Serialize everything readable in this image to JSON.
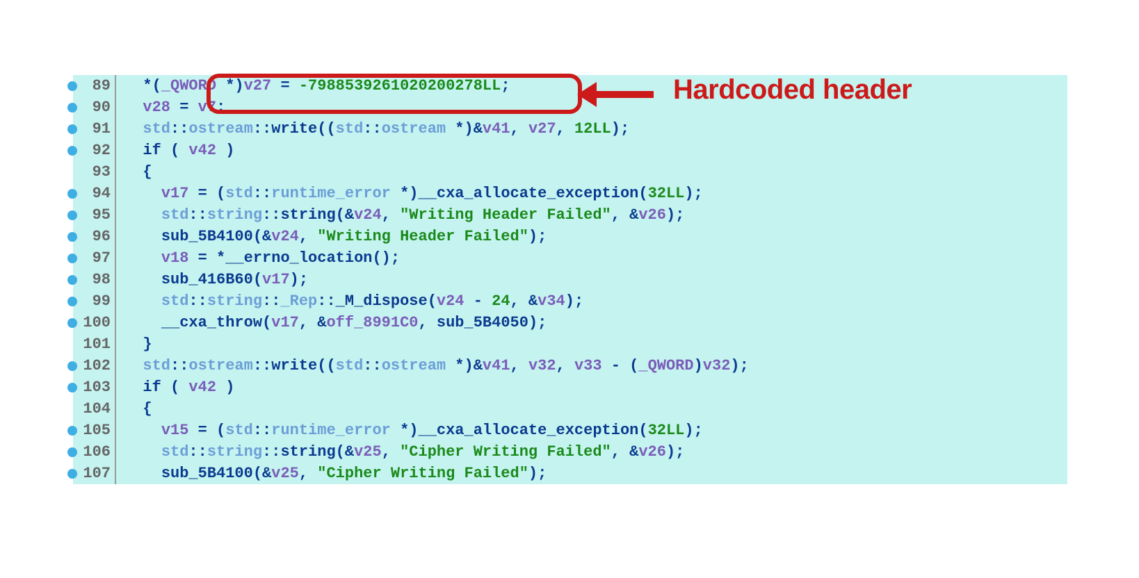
{
  "annotation": {
    "label": "Hardcoded header"
  },
  "lines": [
    {
      "n": "89",
      "bullet": true,
      "tokens": [
        {
          "cls": "tk-punct",
          "t": "  *("
        },
        {
          "cls": "tk-var",
          "t": "_QWORD"
        },
        {
          "cls": "tk-punct",
          "t": " *)"
        },
        {
          "cls": "tk-var",
          "t": "v27"
        },
        {
          "cls": "tk-punct",
          "t": " = "
        },
        {
          "cls": "tk-num",
          "t": "-7988539261020200278LL"
        },
        {
          "cls": "tk-punct",
          "t": ";"
        }
      ]
    },
    {
      "n": "90",
      "bullet": true,
      "tokens": [
        {
          "cls": "tk-punct",
          "t": "  "
        },
        {
          "cls": "tk-var",
          "t": "v28"
        },
        {
          "cls": "tk-punct",
          "t": " = "
        },
        {
          "cls": "tk-var",
          "t": "v7"
        },
        {
          "cls": "tk-punct",
          "t": ";"
        }
      ]
    },
    {
      "n": "91",
      "bullet": true,
      "tokens": [
        {
          "cls": "tk-punct",
          "t": "  "
        },
        {
          "cls": "tk-ns",
          "t": "std"
        },
        {
          "cls": "tk-nsop",
          "t": "::"
        },
        {
          "cls": "tk-ns",
          "t": "ostream"
        },
        {
          "cls": "tk-nsop",
          "t": "::"
        },
        {
          "cls": "tk-fn",
          "t": "write"
        },
        {
          "cls": "tk-punct",
          "t": "(("
        },
        {
          "cls": "tk-ns",
          "t": "std"
        },
        {
          "cls": "tk-nsop",
          "t": "::"
        },
        {
          "cls": "tk-ns",
          "t": "ostream"
        },
        {
          "cls": "tk-punct",
          "t": " *)&"
        },
        {
          "cls": "tk-var",
          "t": "v41"
        },
        {
          "cls": "tk-punct",
          "t": ", "
        },
        {
          "cls": "tk-var",
          "t": "v27"
        },
        {
          "cls": "tk-punct",
          "t": ", "
        },
        {
          "cls": "tk-num",
          "t": "12LL"
        },
        {
          "cls": "tk-punct",
          "t": ");"
        }
      ]
    },
    {
      "n": "92",
      "bullet": true,
      "tokens": [
        {
          "cls": "tk-punct",
          "t": "  "
        },
        {
          "cls": "tk-kw",
          "t": "if"
        },
        {
          "cls": "tk-punct",
          "t": " ( "
        },
        {
          "cls": "tk-var",
          "t": "v42"
        },
        {
          "cls": "tk-punct",
          "t": " )"
        }
      ]
    },
    {
      "n": "93",
      "bullet": false,
      "tokens": [
        {
          "cls": "tk-punct",
          "t": "  {"
        }
      ]
    },
    {
      "n": "94",
      "bullet": true,
      "tokens": [
        {
          "cls": "tk-punct",
          "t": "    "
        },
        {
          "cls": "tk-var",
          "t": "v17"
        },
        {
          "cls": "tk-punct",
          "t": " = ("
        },
        {
          "cls": "tk-ns",
          "t": "std"
        },
        {
          "cls": "tk-nsop",
          "t": "::"
        },
        {
          "cls": "tk-ns",
          "t": "runtime_error"
        },
        {
          "cls": "tk-punct",
          "t": " *)"
        },
        {
          "cls": "tk-fn",
          "t": "__cxa_allocate_exception"
        },
        {
          "cls": "tk-punct",
          "t": "("
        },
        {
          "cls": "tk-num",
          "t": "32LL"
        },
        {
          "cls": "tk-punct",
          "t": ");"
        }
      ]
    },
    {
      "n": "95",
      "bullet": true,
      "tokens": [
        {
          "cls": "tk-punct",
          "t": "    "
        },
        {
          "cls": "tk-ns",
          "t": "std"
        },
        {
          "cls": "tk-nsop",
          "t": "::"
        },
        {
          "cls": "tk-ns",
          "t": "string"
        },
        {
          "cls": "tk-nsop",
          "t": "::"
        },
        {
          "cls": "tk-fn",
          "t": "string"
        },
        {
          "cls": "tk-punct",
          "t": "(&"
        },
        {
          "cls": "tk-var",
          "t": "v24"
        },
        {
          "cls": "tk-punct",
          "t": ", "
        },
        {
          "cls": "tk-str",
          "t": "\"Writing Header Failed\""
        },
        {
          "cls": "tk-punct",
          "t": ", &"
        },
        {
          "cls": "tk-var",
          "t": "v26"
        },
        {
          "cls": "tk-punct",
          "t": ");"
        }
      ]
    },
    {
      "n": "96",
      "bullet": true,
      "tokens": [
        {
          "cls": "tk-punct",
          "t": "    "
        },
        {
          "cls": "tk-fn",
          "t": "sub_5B4100"
        },
        {
          "cls": "tk-punct",
          "t": "(&"
        },
        {
          "cls": "tk-var",
          "t": "v24"
        },
        {
          "cls": "tk-punct",
          "t": ", "
        },
        {
          "cls": "tk-str",
          "t": "\"Writing Header Failed\""
        },
        {
          "cls": "tk-punct",
          "t": ");"
        }
      ]
    },
    {
      "n": "97",
      "bullet": true,
      "tokens": [
        {
          "cls": "tk-punct",
          "t": "    "
        },
        {
          "cls": "tk-var",
          "t": "v18"
        },
        {
          "cls": "tk-punct",
          "t": " = *"
        },
        {
          "cls": "tk-fn",
          "t": "__errno_location"
        },
        {
          "cls": "tk-punct",
          "t": "();"
        }
      ]
    },
    {
      "n": "98",
      "bullet": true,
      "tokens": [
        {
          "cls": "tk-punct",
          "t": "    "
        },
        {
          "cls": "tk-fn",
          "t": "sub_416B60"
        },
        {
          "cls": "tk-punct",
          "t": "("
        },
        {
          "cls": "tk-var",
          "t": "v17"
        },
        {
          "cls": "tk-punct",
          "t": ");"
        }
      ]
    },
    {
      "n": "99",
      "bullet": true,
      "tokens": [
        {
          "cls": "tk-punct",
          "t": "    "
        },
        {
          "cls": "tk-ns",
          "t": "std"
        },
        {
          "cls": "tk-nsop",
          "t": "::"
        },
        {
          "cls": "tk-ns",
          "t": "string"
        },
        {
          "cls": "tk-nsop",
          "t": "::"
        },
        {
          "cls": "tk-ns",
          "t": "_Rep"
        },
        {
          "cls": "tk-nsop",
          "t": "::"
        },
        {
          "cls": "tk-fn",
          "t": "_M_dispose"
        },
        {
          "cls": "tk-punct",
          "t": "("
        },
        {
          "cls": "tk-var",
          "t": "v24"
        },
        {
          "cls": "tk-punct",
          "t": " - "
        },
        {
          "cls": "tk-num",
          "t": "24"
        },
        {
          "cls": "tk-punct",
          "t": ", &"
        },
        {
          "cls": "tk-var",
          "t": "v34"
        },
        {
          "cls": "tk-punct",
          "t": ");"
        }
      ]
    },
    {
      "n": "100",
      "bullet": true,
      "tokens": [
        {
          "cls": "tk-punct",
          "t": "    "
        },
        {
          "cls": "tk-fn",
          "t": "__cxa_throw"
        },
        {
          "cls": "tk-punct",
          "t": "("
        },
        {
          "cls": "tk-var",
          "t": "v17"
        },
        {
          "cls": "tk-punct",
          "t": ", &"
        },
        {
          "cls": "tk-var",
          "t": "off_8991C0"
        },
        {
          "cls": "tk-punct",
          "t": ", "
        },
        {
          "cls": "tk-fn",
          "t": "sub_5B4050"
        },
        {
          "cls": "tk-punct",
          "t": ");"
        }
      ]
    },
    {
      "n": "101",
      "bullet": false,
      "tokens": [
        {
          "cls": "tk-punct",
          "t": "  }"
        }
      ]
    },
    {
      "n": "102",
      "bullet": true,
      "tokens": [
        {
          "cls": "tk-punct",
          "t": "  "
        },
        {
          "cls": "tk-ns",
          "t": "std"
        },
        {
          "cls": "tk-nsop",
          "t": "::"
        },
        {
          "cls": "tk-ns",
          "t": "ostream"
        },
        {
          "cls": "tk-nsop",
          "t": "::"
        },
        {
          "cls": "tk-fn",
          "t": "write"
        },
        {
          "cls": "tk-punct",
          "t": "(("
        },
        {
          "cls": "tk-ns",
          "t": "std"
        },
        {
          "cls": "tk-nsop",
          "t": "::"
        },
        {
          "cls": "tk-ns",
          "t": "ostream"
        },
        {
          "cls": "tk-punct",
          "t": " *)&"
        },
        {
          "cls": "tk-var",
          "t": "v41"
        },
        {
          "cls": "tk-punct",
          "t": ", "
        },
        {
          "cls": "tk-var",
          "t": "v32"
        },
        {
          "cls": "tk-punct",
          "t": ", "
        },
        {
          "cls": "tk-var",
          "t": "v33"
        },
        {
          "cls": "tk-punct",
          "t": " - ("
        },
        {
          "cls": "tk-var",
          "t": "_QWORD"
        },
        {
          "cls": "tk-punct",
          "t": ")"
        },
        {
          "cls": "tk-var",
          "t": "v32"
        },
        {
          "cls": "tk-punct",
          "t": ");"
        }
      ]
    },
    {
      "n": "103",
      "bullet": true,
      "tokens": [
        {
          "cls": "tk-punct",
          "t": "  "
        },
        {
          "cls": "tk-kw",
          "t": "if"
        },
        {
          "cls": "tk-punct",
          "t": " ( "
        },
        {
          "cls": "tk-var",
          "t": "v42"
        },
        {
          "cls": "tk-punct",
          "t": " )"
        }
      ]
    },
    {
      "n": "104",
      "bullet": false,
      "tokens": [
        {
          "cls": "tk-punct",
          "t": "  {"
        }
      ]
    },
    {
      "n": "105",
      "bullet": true,
      "tokens": [
        {
          "cls": "tk-punct",
          "t": "    "
        },
        {
          "cls": "tk-var",
          "t": "v15"
        },
        {
          "cls": "tk-punct",
          "t": " = ("
        },
        {
          "cls": "tk-ns",
          "t": "std"
        },
        {
          "cls": "tk-nsop",
          "t": "::"
        },
        {
          "cls": "tk-ns",
          "t": "runtime_error"
        },
        {
          "cls": "tk-punct",
          "t": " *)"
        },
        {
          "cls": "tk-fn",
          "t": "__cxa_allocate_exception"
        },
        {
          "cls": "tk-punct",
          "t": "("
        },
        {
          "cls": "tk-num",
          "t": "32LL"
        },
        {
          "cls": "tk-punct",
          "t": ");"
        }
      ]
    },
    {
      "n": "106",
      "bullet": true,
      "tokens": [
        {
          "cls": "tk-punct",
          "t": "    "
        },
        {
          "cls": "tk-ns",
          "t": "std"
        },
        {
          "cls": "tk-nsop",
          "t": "::"
        },
        {
          "cls": "tk-ns",
          "t": "string"
        },
        {
          "cls": "tk-nsop",
          "t": "::"
        },
        {
          "cls": "tk-fn",
          "t": "string"
        },
        {
          "cls": "tk-punct",
          "t": "(&"
        },
        {
          "cls": "tk-var",
          "t": "v25"
        },
        {
          "cls": "tk-punct",
          "t": ", "
        },
        {
          "cls": "tk-str",
          "t": "\"Cipher Writing Failed\""
        },
        {
          "cls": "tk-punct",
          "t": ", &"
        },
        {
          "cls": "tk-var",
          "t": "v26"
        },
        {
          "cls": "tk-punct",
          "t": ");"
        }
      ]
    },
    {
      "n": "107",
      "bullet": true,
      "tokens": [
        {
          "cls": "tk-punct",
          "t": "    "
        },
        {
          "cls": "tk-fn",
          "t": "sub_5B4100"
        },
        {
          "cls": "tk-punct",
          "t": "(&"
        },
        {
          "cls": "tk-var",
          "t": "v25"
        },
        {
          "cls": "tk-punct",
          "t": ", "
        },
        {
          "cls": "tk-str",
          "t": "\"Cipher Writing Failed\""
        },
        {
          "cls": "tk-punct",
          "t": ");"
        }
      ]
    }
  ]
}
